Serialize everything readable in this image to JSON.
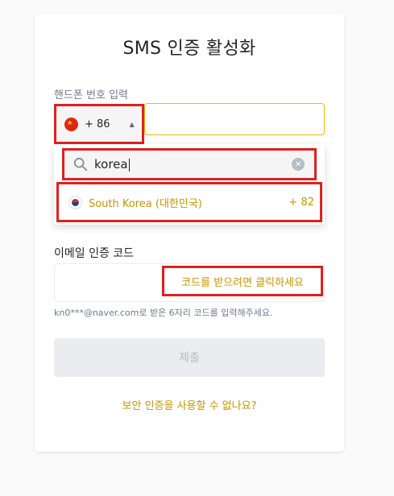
{
  "title": "SMS 인증 활성화",
  "phone": {
    "label": "핸드폰 번호 입력",
    "selected_code": "+ 86",
    "selected_flag": "china-flag-icon",
    "value": ""
  },
  "dropdown": {
    "search_value": "korea",
    "results": [
      {
        "name": "South Korea (대한민국)",
        "code": "+ 82",
        "flag": "south-korea-flag-icon"
      }
    ]
  },
  "email": {
    "label": "이메일 인증 코드",
    "value": "",
    "get_code_label": "코드를 받으려면 클릭하세요",
    "hint": "kn0***@naver.com로 받은 6자리 코드를 입력해주세요."
  },
  "submit_label": "제출",
  "help_link": "보안 인증을 사용할 수 없나요?",
  "colors": {
    "accent": "#c99400",
    "highlight_border": "#e02020",
    "input_focus": "#f0b90b"
  }
}
